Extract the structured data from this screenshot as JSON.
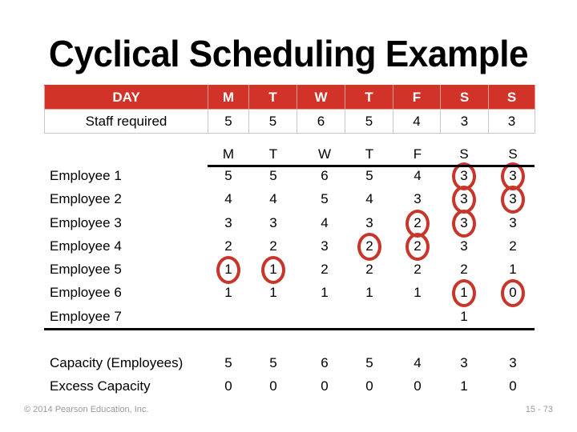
{
  "title": "Cyclical Scheduling Example",
  "requirements_table": {
    "header_label": "DAY",
    "days": [
      "M",
      "T",
      "W",
      "T",
      "F",
      "S",
      "S"
    ],
    "row_label": "Staff required",
    "values": [
      "5",
      "5",
      "6",
      "5",
      "4",
      "3",
      "3"
    ],
    "header_color": "#d13329"
  },
  "schedule": {
    "day_headers": [
      "M",
      "T",
      "W",
      "T",
      "F",
      "S",
      "S"
    ],
    "employees": [
      {
        "label": "Employee 1",
        "values": [
          "5",
          "5",
          "6",
          "5",
          "4",
          "3",
          "3"
        ],
        "circled": [
          5,
          6
        ]
      },
      {
        "label": "Employee 2",
        "values": [
          "4",
          "4",
          "5",
          "4",
          "3",
          "3",
          "3"
        ],
        "circled": [
          5,
          6
        ]
      },
      {
        "label": "Employee 3",
        "values": [
          "3",
          "3",
          "4",
          "3",
          "2",
          "3",
          "3"
        ],
        "circled": [
          4,
          5
        ]
      },
      {
        "label": "Employee 4",
        "values": [
          "2",
          "2",
          "3",
          "2",
          "2",
          "3",
          "2"
        ],
        "circled": [
          3,
          4
        ]
      },
      {
        "label": "Employee 5",
        "values": [
          "1",
          "1",
          "2",
          "2",
          "2",
          "2",
          "1"
        ],
        "circled": [
          0,
          1
        ]
      },
      {
        "label": "Employee 6",
        "values": [
          "1",
          "1",
          "1",
          "1",
          "1",
          "1",
          "0"
        ],
        "circled": [
          5,
          6
        ]
      },
      {
        "label": "Employee 7",
        "values": [
          "",
          "",
          "",
          "",
          "",
          "1",
          ""
        ],
        "circled": []
      }
    ],
    "summary": [
      {
        "label": "Capacity (Employees)",
        "values": [
          "5",
          "5",
          "6",
          "5",
          "4",
          "3",
          "3"
        ]
      },
      {
        "label": "Excess Capacity",
        "values": [
          "0",
          "0",
          "0",
          "0",
          "0",
          "1",
          "0"
        ]
      }
    ],
    "circle_color": "#c8352a"
  },
  "footer": {
    "copyright": "© 2014 Pearson Education, Inc.",
    "page": "15 - 73"
  }
}
